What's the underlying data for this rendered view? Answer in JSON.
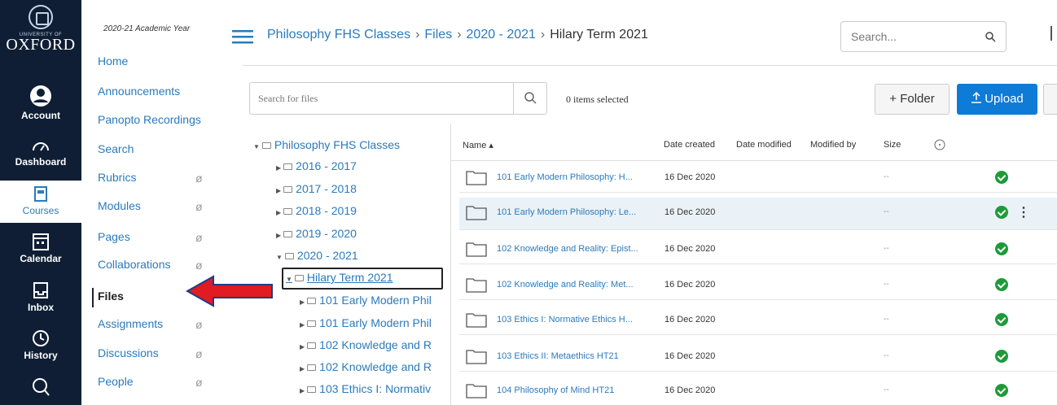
{
  "global_nav": {
    "logo_small": "UNIVERSITY OF",
    "logo_big": "OXFORD",
    "items": [
      {
        "label": "Account",
        "icon": "account-icon"
      },
      {
        "label": "Dashboard",
        "icon": "dashboard-icon"
      },
      {
        "label": "Courses",
        "icon": "courses-icon"
      },
      {
        "label": "Calendar",
        "icon": "calendar-icon"
      },
      {
        "label": "Inbox",
        "icon": "inbox-icon"
      },
      {
        "label": "History",
        "icon": "history-icon"
      }
    ]
  },
  "course_nav": {
    "academic_year": "2020-21 Academic Year",
    "items": [
      {
        "label": "Home"
      },
      {
        "label": "Announcements"
      },
      {
        "label": "Panopto Recordings"
      },
      {
        "label": "Search"
      },
      {
        "label": "Rubrics",
        "hidden": true
      },
      {
        "label": "Modules",
        "hidden": true
      },
      {
        "label": "Pages",
        "hidden": true
      },
      {
        "label": "Collaborations",
        "hidden": true
      },
      {
        "label": "Files",
        "active": true
      },
      {
        "label": "Assignments",
        "hidden": true
      },
      {
        "label": "Discussions",
        "hidden": true
      },
      {
        "label": "People",
        "hidden": true
      }
    ],
    "eye_glyph": "ø"
  },
  "breadcrumb": {
    "items": [
      "Philosophy FHS Classes",
      "Files",
      "2020 - 2021",
      "Hilary Term 2021"
    ],
    "separator": "›"
  },
  "header_search": {
    "placeholder": "Search..."
  },
  "toolbar": {
    "search_placeholder": "Search for files",
    "selected_count": "0 items selected",
    "folder_button": "+ Folder",
    "upload_button": "Upload"
  },
  "tree": {
    "root": "Philosophy FHS Classes",
    "nodes": [
      {
        "label": "2016 - 2017",
        "expanded": false
      },
      {
        "label": "2017 - 2018",
        "expanded": false
      },
      {
        "label": "2018 - 2019",
        "expanded": false
      },
      {
        "label": "2019 - 2020",
        "expanded": false
      },
      {
        "label": "2020 - 2021",
        "expanded": true
      },
      {
        "label": "Hilary Term 2021",
        "expanded": true,
        "selected": true
      },
      {
        "label": "101 Early Modern Phil",
        "expanded": false
      },
      {
        "label": "101 Early Modern Phil",
        "expanded": false
      },
      {
        "label": "102 Knowledge and R",
        "expanded": false
      },
      {
        "label": "102 Knowledge and R",
        "expanded": false
      },
      {
        "label": "103 Ethics I: Normativ",
        "expanded": false
      }
    ]
  },
  "table": {
    "headers": {
      "name": "Name ▴",
      "created": "Date created",
      "modified": "Date modified",
      "modified_by": "Modified by",
      "size": "Size"
    },
    "rows": [
      {
        "name": "101 Early Modern Philosophy: H...",
        "created": "16 Dec 2020",
        "size": "--",
        "highlighted": false
      },
      {
        "name": "101 Early Modern Philosophy: Le...",
        "created": "16 Dec 2020",
        "size": "--",
        "highlighted": true
      },
      {
        "name": "102 Knowledge and Reality: Epist...",
        "created": "16 Dec 2020",
        "size": "--",
        "highlighted": false
      },
      {
        "name": "102 Knowledge and Reality: Met...",
        "created": "16 Dec 2020",
        "size": "--",
        "highlighted": false
      },
      {
        "name": "103 Ethics I: Normative Ethics H...",
        "created": "16 Dec 2020",
        "size": "--",
        "highlighted": false
      },
      {
        "name": "103 Ethics II: Metaethics HT21",
        "created": "16 Dec 2020",
        "size": "--",
        "highlighted": false
      },
      {
        "name": "104 Philosophy of Mind HT21",
        "created": "16 Dec 2020",
        "size": "--",
        "highlighted": false
      }
    ]
  },
  "colors": {
    "nav_bg": "#0f1e35",
    "link": "#2b7abc",
    "upload": "#0e7bd6",
    "published": "#1f9a3a",
    "arrow": "#e11b22"
  }
}
